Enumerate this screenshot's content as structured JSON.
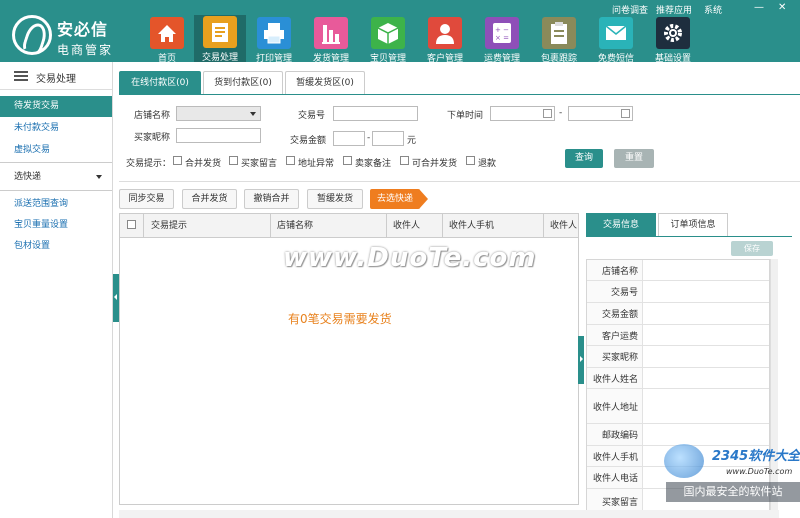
{
  "brand": {
    "name": "安必信",
    "subtitle": "电商管家"
  },
  "top_links": [
    "问卷调查",
    "推荐应用",
    "系统"
  ],
  "window_buttons": {
    "minimize": "—",
    "close": "✕"
  },
  "nav": [
    {
      "label": "首页",
      "icon": "home-icon",
      "color": "#e4552a"
    },
    {
      "label": "交易处理",
      "icon": "document-list-icon",
      "color": "#e8a01e"
    },
    {
      "label": "打印管理",
      "icon": "printer-icon",
      "color": "#2a8fd6"
    },
    {
      "label": "发货管理",
      "icon": "bar-chart-icon",
      "color": "#e85a9a"
    },
    {
      "label": "宝贝管理",
      "icon": "box-icon",
      "color": "#3db34a"
    },
    {
      "label": "客户管理",
      "icon": "person-icon",
      "color": "#e04a3c"
    },
    {
      "label": "运费管理",
      "icon": "calculator-icon",
      "color": "#8e4fb8"
    },
    {
      "label": "包裹跟踪",
      "icon": "clipboard-icon",
      "color": "#8a8a5a"
    },
    {
      "label": "免费短信",
      "icon": "mail-icon",
      "color": "#2ab3b8"
    },
    {
      "label": "基础设置",
      "icon": "gear-icon",
      "color": "#1e2e3e"
    }
  ],
  "sidebar": {
    "header": "交易处理",
    "items": [
      {
        "label": "待发货交易",
        "active": true
      },
      {
        "label": "未付款交易"
      },
      {
        "label": "虚拟交易"
      },
      {
        "label": "选快递"
      },
      {
        "label": "派送范围查询"
      },
      {
        "label": "宝贝重量设置"
      },
      {
        "label": "包材设置"
      }
    ]
  },
  "tabs": [
    {
      "label": "在线付款区(0)",
      "active": true
    },
    {
      "label": "货到付款区(0)"
    },
    {
      "label": "暂缓发货区(0)"
    }
  ],
  "form": {
    "shop_name_label": "店铺名称",
    "buyer_nick_label": "买家昵称",
    "trade_no_label": "交易号",
    "amount_label": "交易金额",
    "amount_sep": "-",
    "amount_unit": "元",
    "order_time_label": "下单时间",
    "time_sep": "-",
    "hints_label": "交易提示：",
    "hints": [
      "合并发货",
      "买家留言",
      "地址异常",
      "卖家备注",
      "可合并发货",
      "退款"
    ],
    "query_button": "查询",
    "reset_button": "重置"
  },
  "actions": [
    "同步交易",
    "合并发货",
    "撤销合并",
    "暂缓发货",
    "去选快递"
  ],
  "table": {
    "columns": [
      "交易提示",
      "店铺名称",
      "收件人",
      "收件人手机",
      "收件人"
    ],
    "empty_message": "有0笔交易需要发货"
  },
  "right_panel": {
    "tabs": [
      {
        "label": "交易信息",
        "active": true
      },
      {
        "label": "订单项信息"
      }
    ],
    "save_button": "保存",
    "fields": [
      "店铺名称",
      "交易号",
      "交易金额",
      "客户运费",
      "买家昵称",
      "收件人姓名",
      "收件人地址",
      "邮政编码",
      "收件人手机",
      "收件人电话",
      "买家留言"
    ]
  },
  "watermarks": {
    "main": "www.DuoTe.com",
    "brand_2345": "2345软件大全",
    "brand_url": "www.DuoTe.com",
    "bottom": "国内最安全的软件站"
  }
}
